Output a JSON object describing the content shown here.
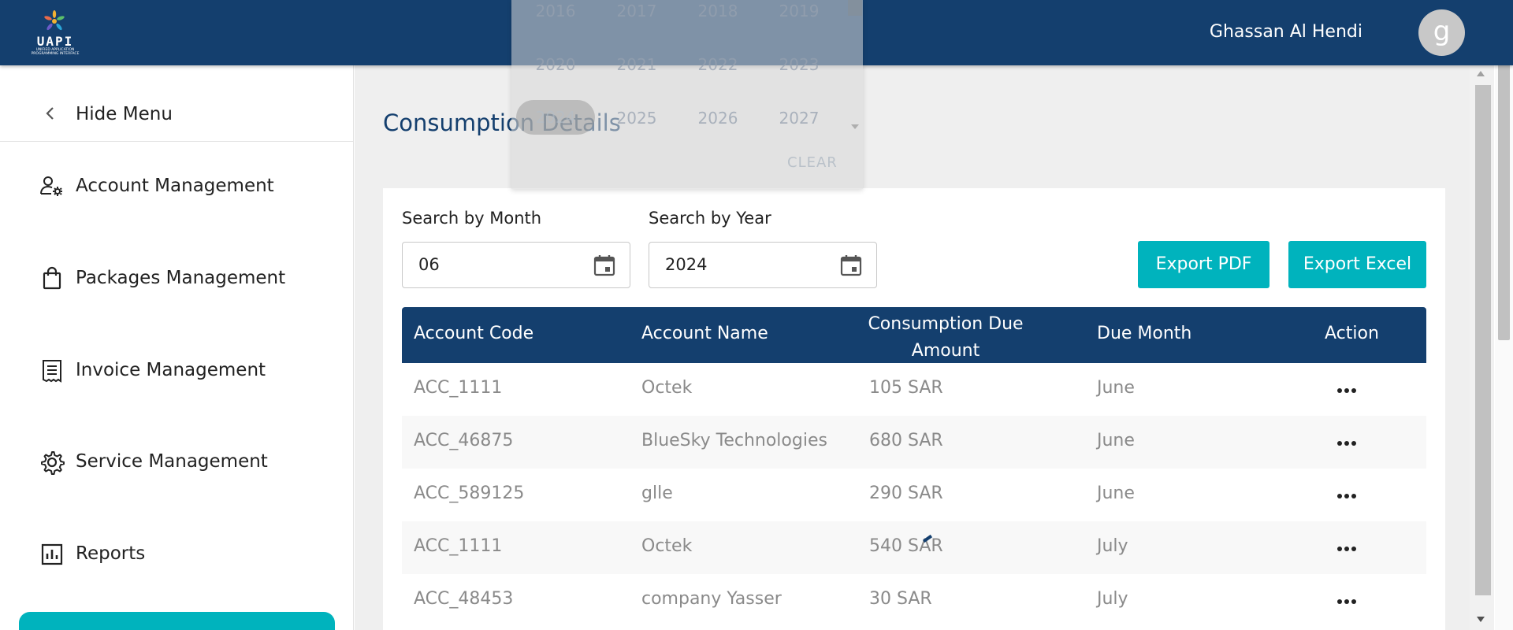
{
  "header": {
    "logo": {
      "brand": "UAPI",
      "tagline": "UNIFIED APPLICATION PROGRAMMING INTERFACE"
    },
    "user_name": "Ghassan Al Hendi",
    "avatar_initial": "g"
  },
  "sidebar": {
    "hide_menu_label": "Hide Menu",
    "items": [
      {
        "label": "Account Management",
        "icon": "user-gear-icon"
      },
      {
        "label": "Packages Management",
        "icon": "bag-icon"
      },
      {
        "label": "Invoice Management",
        "icon": "receipt-icon"
      },
      {
        "label": "Service Management",
        "icon": "gear-icon"
      },
      {
        "label": "Reports",
        "icon": "bar-chart-icon"
      }
    ]
  },
  "main": {
    "title": "Consumption Details",
    "filters": {
      "month_label": "Search by Month",
      "month_value": "06",
      "year_label": "Search by Year",
      "year_value": "2024"
    },
    "buttons": {
      "export_pdf": "Export PDF",
      "export_excel": "Export Excel"
    },
    "table": {
      "headers": [
        "Account Code",
        "Account Name",
        "Consumption Due Amount",
        "Due Month",
        "Action"
      ],
      "header_amount_lines": [
        "Consumption Due",
        "Amount"
      ],
      "rows": [
        {
          "code": "ACC_1111",
          "name": "Octek",
          "amount": "105 SAR",
          "month": "June"
        },
        {
          "code": "ACC_46875",
          "name": "BlueSky Technologies",
          "amount": "680 SAR",
          "month": "June"
        },
        {
          "code": "ACC_589125",
          "name": "glle",
          "amount": "290 SAR",
          "month": "June"
        },
        {
          "code": "ACC_1111",
          "name": "Octek",
          "amount": "540 SAR",
          "month": "July"
        },
        {
          "code": "ACC_48453",
          "name": "company Yasser",
          "amount": "30 SAR",
          "month": "July"
        }
      ]
    }
  },
  "year_picker": {
    "years": [
      "2016",
      "2017",
      "2018",
      "2019",
      "2020",
      "2021",
      "2022",
      "2023",
      "2024",
      "2025",
      "2026",
      "2027"
    ],
    "selected": "2024",
    "clear_label": "CLEAR"
  },
  "colors": {
    "primary": "#143f6e",
    "accent": "#00b3bd",
    "background": "#efefef"
  }
}
